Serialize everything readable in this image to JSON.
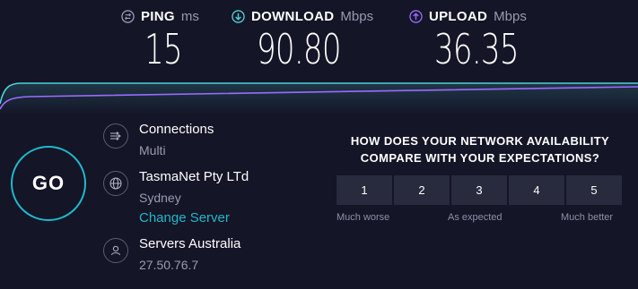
{
  "metrics": {
    "ping": {
      "label": "PING",
      "unit": "ms",
      "value": "15",
      "icon": "ping-icon"
    },
    "download": {
      "label": "DOWNLOAD",
      "unit": "Mbps",
      "value": "90.80",
      "icon": "download-arrow-icon"
    },
    "upload": {
      "label": "UPLOAD",
      "unit": "Mbps",
      "value": "36.35",
      "icon": "upload-arrow-icon"
    }
  },
  "colors": {
    "accent": "#1fb8cd",
    "download": "#4fd1d9",
    "upload": "#9b6bff",
    "background": "#141526"
  },
  "go_label": "GO",
  "connections": {
    "label": "Connections",
    "value": "Multi",
    "icon": "connections-icon"
  },
  "isp": {
    "name": "TasmaNet Pty LTd",
    "location": "Sydney",
    "change_label": "Change Server",
    "icon": "globe-icon"
  },
  "server": {
    "name": "Servers Australia",
    "ip": "27.50.76.7",
    "icon": "user-icon"
  },
  "survey": {
    "question_line1": "HOW DOES YOUR NETWORK AVAILABILITY",
    "question_line2": "COMPARE WITH YOUR EXPECTATIONS?",
    "options": [
      "1",
      "2",
      "3",
      "4",
      "5"
    ],
    "low_label": "Much worse",
    "mid_label": "As expected",
    "high_label": "Much better"
  }
}
